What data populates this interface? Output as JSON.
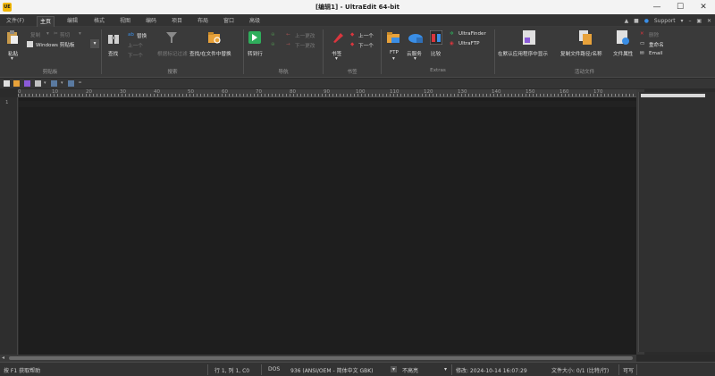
{
  "window": {
    "logo": "UE",
    "title": "[编辑1] - UltraEdit 64-bit",
    "minimize": "—",
    "maximize": "☐",
    "close": "✕"
  },
  "menu": {
    "tabs": [
      "文件(F)",
      "主页",
      "编辑",
      "格式",
      "视图",
      "编码",
      "项目",
      "布局",
      "窗口",
      "高级"
    ],
    "active_index": 1,
    "support_label": "Support",
    "right_icons": [
      "up-arrow-icon",
      "layout-icon",
      "help-icon"
    ]
  },
  "ribbon": {
    "clipboard": {
      "paste": "粘贴",
      "copy": "复制",
      "cut": "剪切",
      "clipboard_select": "Windows 剪贴板",
      "group": "剪贴板"
    },
    "search": {
      "find": "查找",
      "replace": "替换",
      "prev": "上一个",
      "next": "下一个",
      "filter": "根据标记过滤",
      "find_in_files": "查找/在文件中替换",
      "group": "搜索"
    },
    "navigate": {
      "goto": "转到行",
      "prev_change": "上一更改",
      "next_change": "下一更改",
      "group": "导航"
    },
    "bookmark": {
      "bookmark": "书签",
      "prev": "上一个",
      "next": "下一个",
      "group": "书签"
    },
    "extras": {
      "ftp": "FTP",
      "cloud": "云服务",
      "compare": "比较",
      "ultrafinder": "UltraFinder",
      "ultraftp": "UltraFTP",
      "group": "Extras"
    },
    "active_file": {
      "show_in_default": "在默认应用程序中显示",
      "copy_path": "复制文件路径/名称",
      "properties": "文件属性",
      "delete": "删除",
      "rename": "重命名",
      "email": "Email",
      "group": "活动文件"
    }
  },
  "ruler": {
    "labels": [
      "0",
      "10",
      "20",
      "30",
      "40",
      "50",
      "60",
      "70",
      "80",
      "90",
      "100",
      "110",
      "120",
      "130",
      "140",
      "150",
      "160",
      "170"
    ]
  },
  "editor": {
    "line_numbers": [
      "1"
    ],
    "content": ""
  },
  "status": {
    "help": "按 F1 获取帮助",
    "position": "行 1, 列 1, C0",
    "line_ending": "DOS",
    "encoding": "936  (ANSI/OEM - 简体中文 GBK)",
    "highlight": "不高亮",
    "modified": "修改:  2024-10-14 16:07:29",
    "filesize": "文件大小:  0/1  (比特/行)",
    "writable": "可写"
  },
  "colors": {
    "editor_bg": "#1e1e1e",
    "ribbon_bg": "#3a3a3a",
    "accent_green": "#2fae5c",
    "accent_blue": "#3a8ee6",
    "accent_red": "#d9363e",
    "accent_orange": "#e8a23a"
  }
}
